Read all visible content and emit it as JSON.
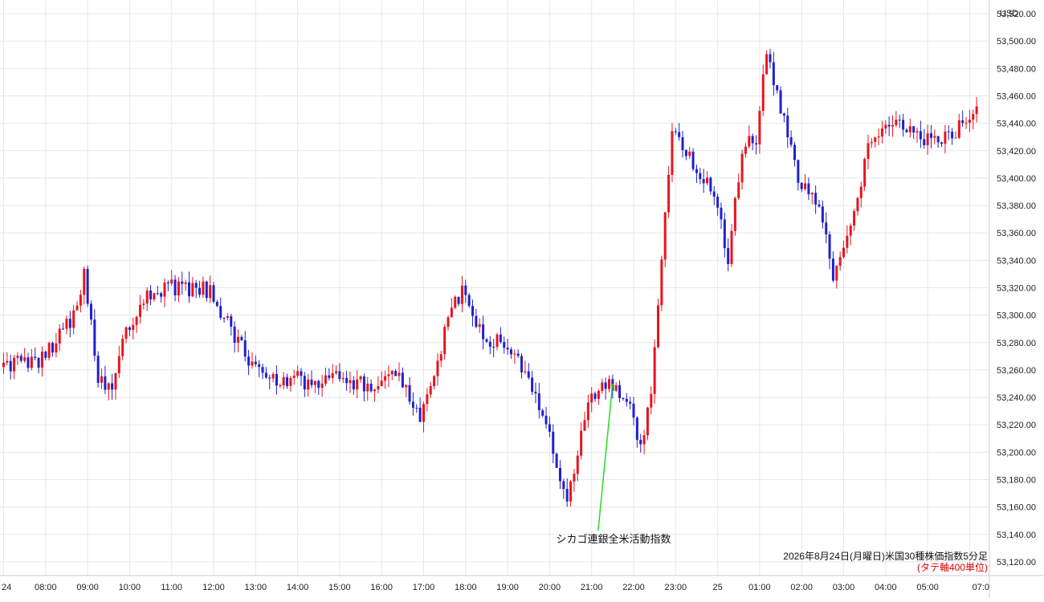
{
  "chart_data": {
    "type": "candlestick",
    "title": "2026年8月24日(月曜日)米国30種株価指数5分足",
    "note": "(タテ軸400単位)",
    "currency": "USD",
    "annotation": "シカゴ連銀全米活動指数",
    "annotation_time": "21:30",
    "x_ticks": [
      "24",
      "08:00",
      "09:00",
      "10:00",
      "11:00",
      "12:00",
      "13:00",
      "14:00",
      "15:00",
      "16:00",
      "17:00",
      "18:00",
      "19:00",
      "20:00",
      "21:00",
      "22:00",
      "23:00",
      "25",
      "01:00",
      "02:00",
      "03:00",
      "04:00",
      "05:00",
      "07:0"
    ],
    "y_ticks": [
      "53,520.00",
      "53,500.00",
      "53,480.00",
      "53,460.00",
      "53,440.00",
      "53,420.00",
      "53,400.00",
      "53,380.00",
      "53,360.00",
      "53,340.00",
      "53,320.00",
      "53,300.00",
      "53,280.00",
      "53,260.00",
      "53,240.00",
      "53,220.00",
      "53,200.00",
      "53,180.00",
      "53,160.00",
      "53,140.00",
      "53,120.00"
    ],
    "ylim": [
      53110,
      53530
    ],
    "up_color": "#e8141e",
    "down_color": "#2020cc",
    "annotation_color": "#22dd22",
    "grid": true,
    "anchors": [
      [
        "07:00",
        53262
      ],
      [
        "08:00",
        53268
      ],
      [
        "08:45",
        53300
      ],
      [
        "09:00",
        53330
      ],
      [
        "09:20",
        53255
      ],
      [
        "09:40",
        53245
      ],
      [
        "10:00",
        53290
      ],
      [
        "10:30",
        53315
      ],
      [
        "11:00",
        53320
      ],
      [
        "11:20",
        53320
      ],
      [
        "12:00",
        53318
      ],
      [
        "12:30",
        53290
      ],
      [
        "13:00",
        53262
      ],
      [
        "13:30",
        53252
      ],
      [
        "14:00",
        53255
      ],
      [
        "14:30",
        53248
      ],
      [
        "15:00",
        53255
      ],
      [
        "15:30",
        53250
      ],
      [
        "16:00",
        53250
      ],
      [
        "16:30",
        53255
      ],
      [
        "17:00",
        53225
      ],
      [
        "17:20",
        53260
      ],
      [
        "17:40",
        53295
      ],
      [
        "18:00",
        53320
      ],
      [
        "18:30",
        53285
      ],
      [
        "19:00",
        53278
      ],
      [
        "19:30",
        53260
      ],
      [
        "20:00",
        53220
      ],
      [
        "20:30",
        53165
      ],
      [
        "20:45",
        53200
      ],
      [
        "21:00",
        53235
      ],
      [
        "21:30",
        53250
      ],
      [
        "22:00",
        53230
      ],
      [
        "22:15",
        53205
      ],
      [
        "22:30",
        53240
      ],
      [
        "22:45",
        53340
      ],
      [
        "23:00",
        53435
      ],
      [
        "23:30",
        53410
      ],
      [
        "24:00",
        53390
      ],
      [
        "24:20",
        53340
      ],
      [
        "24:40",
        53420
      ],
      [
        "25:00",
        53430
      ],
      [
        "25:15",
        53495
      ],
      [
        "25:40",
        53440
      ],
      [
        "26:00",
        53400
      ],
      [
        "26:30",
        53380
      ],
      [
        "26:50",
        53330
      ],
      [
        "27:15",
        53360
      ],
      [
        "27:40",
        53420
      ],
      [
        "28:00",
        53440
      ],
      [
        "28:30",
        53440
      ],
      [
        "29:00",
        53430
      ],
      [
        "29:30",
        53430
      ],
      [
        "30:00",
        53440
      ],
      [
        "30:10",
        53452
      ]
    ]
  }
}
